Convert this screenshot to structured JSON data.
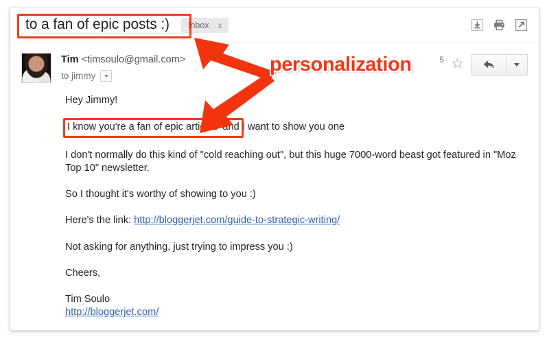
{
  "subject": {
    "text": "to a fan of epic posts :)",
    "label_chip": "Inbox",
    "label_remove": "x"
  },
  "header_icons": [
    {
      "name": "download-icon",
      "title": "Download"
    },
    {
      "name": "print-icon",
      "title": "Print"
    },
    {
      "name": "open-in-new-window-icon",
      "title": "Open in new window"
    }
  ],
  "sender": {
    "name": "Tim",
    "email": "<timsoulo@gmail.com>",
    "recipient": "to jimmy",
    "timestamp_fragment": "5",
    "star_icon": "star-outline-icon",
    "reply_icon": "reply-arrow-icon",
    "more_icon": "chevron-down-icon"
  },
  "body": {
    "greeting": "Hey Jimmy!",
    "highlighted_sentence": "I know you're a fan of epic articles",
    "highlighted_sentence_rest": " and I want to show you one",
    "paragraph_2": "I don't normally do this kind of \"cold reaching out\", but this huge 7000-word beast got featured in \"Moz Top 10\" newsletter.",
    "paragraph_3": "So I thought it's worthy of showing to you :)",
    "link_intro": "Here's the link: ",
    "link_text": "http://bloggerjet.com/guide-to-strategic-writing/",
    "paragraph_5": "Not asking for anything, just trying to impress you :)",
    "signoff": "Cheers,",
    "signature_name": "Tim Soulo",
    "signature_link": "http://bloggerjet.com/"
  },
  "annotation": {
    "label": "personalization",
    "color": "#f2361a",
    "box_color": "#f53a1b",
    "arrow_to_subject": "arrow-up-left-icon",
    "arrow_to_body": "arrow-down-left-icon"
  }
}
